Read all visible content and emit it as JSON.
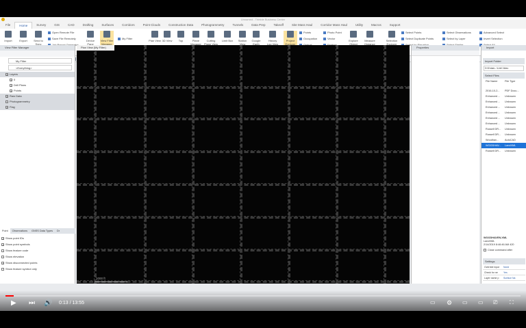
{
  "window": {
    "title": "Unnamed - Trimble Business Center"
  },
  "tabs": [
    "File",
    "Home",
    "Survey",
    "GIS",
    "CAD",
    "Drafting",
    "Surfaces",
    "Corridors",
    "Point Clouds",
    "Construction Data",
    "Photogrammetry",
    "Tunnels",
    "Data Prep",
    "Takeoff",
    "Site Mass Haul",
    "Corridor Mass Haul",
    "Utility",
    "Macros",
    "Support"
  ],
  "active_tab": "Home",
  "ribbon": {
    "large": [
      {
        "label": "Import"
      },
      {
        "label": "Export"
      },
      {
        "label": "Send to Sync"
      },
      {
        "label": "Device Pane"
      },
      {
        "label": "View Filter Manager",
        "highlight": true
      },
      {
        "label": "Plan View"
      },
      {
        "label": "3D View"
      },
      {
        "label": "Top"
      },
      {
        "label": "Plane Manager"
      },
      {
        "label": "Cutting Plane View"
      },
      {
        "label": "Limit Box"
      },
      {
        "label": "Station View"
      },
      {
        "label": "Google Earth"
      },
      {
        "label": "History Log View"
      },
      {
        "label": "Project Explorer",
        "highlight": true
      },
      {
        "label": "Explore Object"
      },
      {
        "label": "Measure Distance"
      },
      {
        "label": "Selection Explorer"
      }
    ],
    "small_exchange": [
      "Open Remote File",
      "Save File Remotely",
      "Job Report Generator"
    ],
    "filter": "My Filter",
    "small_data": [
      "Points",
      "Occupation",
      "Optical",
      "Photo Point",
      "Vector",
      "Feature"
    ],
    "small_selection": [
      "Select Points",
      "Select Duplicate Points",
      "Select by Elevation",
      "Select Observations",
      "Select by Layer",
      "Select Similar",
      "Advanced Select",
      "Invert Selection",
      "Select All"
    ],
    "groups": [
      "Data Exchange",
      "View",
      "Data",
      "Selection"
    ]
  },
  "toolbar": {
    "filter": "My Filter"
  },
  "left_panel": {
    "title": "View Filter Manager",
    "filter_name": "My Filter",
    "filter_value": "<Everything>",
    "tree": [
      {
        "label": "Layers",
        "gray": true
      },
      {
        "label": "0"
      },
      {
        "label": "Drill Plans"
      },
      {
        "label": "Points"
      },
      {
        "label": "Raw Data",
        "gray": true
      },
      {
        "label": "Photogrammetry",
        "gray": true
      },
      {
        "label": "Flag",
        "gray": true
      }
    ],
    "bottom_tabs": [
      "Point",
      "Observations",
      "GNSS Data Types",
      "Dr"
    ],
    "options": [
      {
        "label": "Show point IDs",
        "checked": true
      },
      {
        "label": "Show point symbols",
        "checked": true
      },
      {
        "label": "Show feature code",
        "checked": false
      },
      {
        "label": "Show elevation",
        "checked": false
      },
      {
        "label": "Show disconnected points",
        "checked": true
      },
      {
        "label": "Show feature symbol only",
        "checked": false
      }
    ]
  },
  "view": {
    "tab": "Plan View (My Filter)",
    "scale": "1000 ft"
  },
  "properties": {
    "title": "Properties"
  },
  "import_panel": {
    "title": "Import",
    "folder_header": "Import Folder",
    "folder": "D:\\Entain...\\Unit Video",
    "select_files": "Select Files",
    "col_name": "File Name",
    "col_type": "File Type",
    "files": [
      [
        "2016-10-2...",
        "PDF Docu..."
      ],
      [
        "Enhanced ...",
        "Unknown"
      ],
      [
        "Enhanced ...",
        "Unknown"
      ],
      [
        "Enhanced ...",
        "Unknown"
      ],
      [
        "Enhanced ...",
        "Unknown"
      ],
      [
        "Enhanced ...",
        "Unknown"
      ],
      [
        "Enhanced ...",
        "Unknown"
      ],
      [
        "Russell DR...",
        "Unknown"
      ],
      [
        "Russell DR...",
        "Unknown"
      ],
      [
        "Woodhav...",
        "AutoCAD"
      ],
      [
        "WOODHAV...",
        "LandXML"
      ],
      [
        "Russell DR...",
        "Unknown"
      ]
    ],
    "selected_index": 10,
    "detail_name": "WOODHAVEN.XML",
    "detail_type": "LandXML",
    "detail_date": "2/14/2019 8:46:46 AM  420",
    "close_after": "Close command after",
    "settings": "Settings",
    "settings_rows": [
      [
        "Override input",
        "None"
      ],
      [
        "Check for ne",
        "Yes"
      ],
      [
        "Layer name p",
        "Surface Na"
      ]
    ]
  },
  "video": {
    "time": "0:13 / 13:55",
    "progress": 0.016
  }
}
